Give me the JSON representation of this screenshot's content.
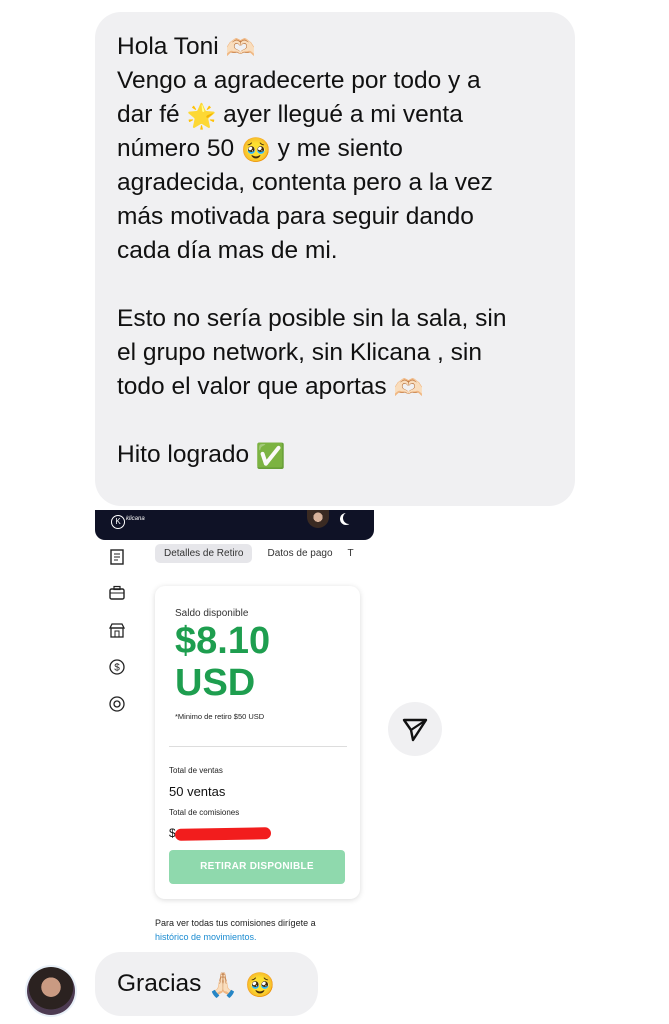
{
  "message": {
    "greeting": "Hola Toni",
    "greeting_emoji": "🫶🏻",
    "line1_a": "Vengo a agradecerte por todo y a",
    "line2_a": "dar fé",
    "star_emoji": "🌟",
    "line2_b": "ayer llegué a mi venta",
    "line3_a": "número 50",
    "pleading_emoji": "🥹",
    "line3_b": "y me siento",
    "line4": "agradecida, contenta pero a la vez",
    "line5": "más motivada para seguir dando",
    "line6": "cada día mas de mi.",
    "line7": "Esto no sería posible sin la sala, sin",
    "line8": "el grupo network, sin Klicana , sin",
    "line9": "todo el valor que aportas",
    "heart_hands_emoji": "🫶🏻",
    "line10": "Hito logrado",
    "check_emoji": "✅"
  },
  "screenshot": {
    "logo_letter": "K",
    "logo_text": "klicana",
    "tabs": [
      "Detalles de Retiro",
      "Datos de pago",
      "T"
    ],
    "saldo_label": "Saldo disponible",
    "amount_line1": "$8.10",
    "amount_line2": "USD",
    "min_note": "*Minimo de retiro $50 USD",
    "total_ventas_label": "Total de ventas",
    "total_ventas_value": "50 ventas",
    "total_comisiones_label": "Total de comisiones",
    "total_comisiones_value": "$",
    "withdraw_button": "RETIRAR DISPONIBLE",
    "footer_text": "Para ver todas tus comisiones dirígete a",
    "footer_link": "histórico de movimientos."
  },
  "reply": {
    "text": "Gracias",
    "pray_emoji": "🙏🏻",
    "pleading_emoji": "🥹"
  },
  "colors": {
    "bubble_bg": "#f0f0f2",
    "amount_green": "#1e9e4f",
    "button_green": "#8fd9ad",
    "link_blue": "#1a8bd1",
    "header_navy": "#0f1226",
    "redaction_red": "#f21d1d"
  }
}
